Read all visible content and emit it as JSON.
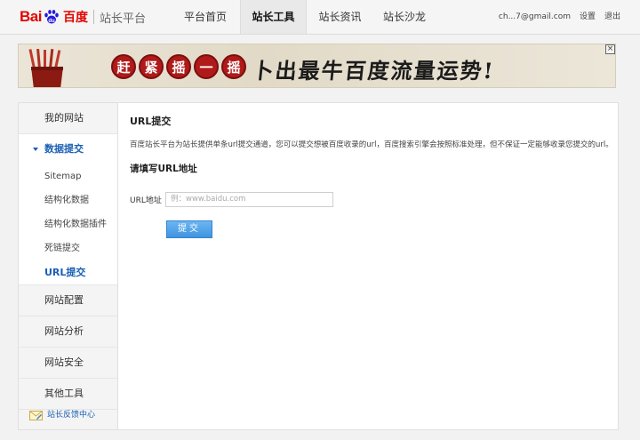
{
  "header": {
    "logo": {
      "bai": "Bai",
      "du": "du",
      "cn": "百度",
      "platform": "站长平台"
    },
    "nav": [
      {
        "label": "平台首页",
        "active": false
      },
      {
        "label": "站长工具",
        "active": true
      },
      {
        "label": "站长资讯",
        "active": false
      },
      {
        "label": "站长沙龙",
        "active": false
      }
    ],
    "user": {
      "email": "ch...7@gmail.com",
      "settings": "设置",
      "logout": "退出"
    }
  },
  "banner": {
    "circles": [
      "赶",
      "紧",
      "摇",
      "一",
      "摇"
    ],
    "slogan": "卜出最牛百度流量运势!",
    "close": "×"
  },
  "sidebar": {
    "my_sites": "我的网站",
    "data_submit": "数据提交",
    "sub_items": [
      "Sitemap",
      "结构化数据",
      "结构化数据插件",
      "死链提交",
      "URL提交"
    ],
    "groups": [
      "网站配置",
      "网站分析",
      "网站安全",
      "其他工具"
    ],
    "feedback": "站长反馈中心"
  },
  "content": {
    "title": "URL提交",
    "description": "百度站长平台为站长提供单条url提交通道，您可以提交想被百度收录的url，百度搜索引擎会按照标准处理，但不保证一定能够收录您提交的url。",
    "section_title": "请填写URL地址",
    "url_label": "URL地址",
    "url_placeholder": "例：www.baidu.com",
    "submit_label": "提交"
  }
}
